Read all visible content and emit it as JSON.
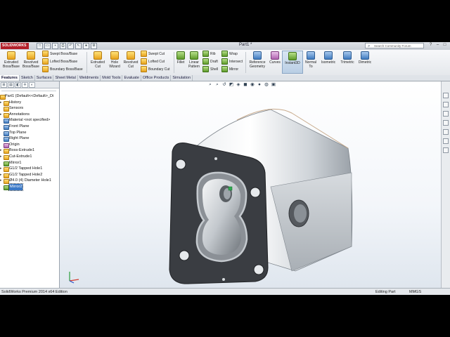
{
  "window": {
    "logo": "SOLIDWORKS",
    "document_title": "Part1 *",
    "search_placeholder": "Search Community Forum",
    "search_icon": "magnifier-icon",
    "window_buttons": [
      "?",
      "–",
      "□",
      "×"
    ]
  },
  "command_manager": {
    "extruded_boss": [
      "Extruded",
      "Boss/Base"
    ],
    "revolved_boss": [
      "Revolved",
      "Boss/Base"
    ],
    "swept_boss": "Swept Boss/Base",
    "lofted_boss": "Lofted Boss/Base",
    "boundary_boss": "Boundary Boss/Base",
    "extruded_cut": [
      "Extruded",
      "Cut"
    ],
    "hole_wizard": [
      "Hole",
      "Wizard"
    ],
    "revolved_cut": [
      "Revolved",
      "Cut"
    ],
    "swept_cut": "Swept Cut",
    "lofted_cut": "Lofted Cut",
    "boundary_cut": "Boundary Cut",
    "fillet": "Fillet",
    "linear_pattern": [
      "Linear",
      "Pattern"
    ],
    "rib": "Rib",
    "draft": "Draft",
    "shell": "Shell",
    "wrap": "Wrap",
    "intersect": "Intersect",
    "mirror": "Mirror",
    "reference_geometry": [
      "Reference",
      "Geometry"
    ],
    "curves": "Curves",
    "instant3d": "Instant3D",
    "normal_to": [
      "Normal",
      "To"
    ],
    "isometric": "Isometric",
    "trimetric": "Trimetric",
    "dimetric": "Dimetric"
  },
  "tabs": [
    "Features",
    "Sketch",
    "Surfaces",
    "Sheet Metal",
    "Weldments",
    "Mold Tools",
    "Evaluate",
    "Office Products",
    "Simulation"
  ],
  "feature_tree": {
    "root": "Part1  (Default<<Default>_Di",
    "items": [
      {
        "label": "History",
        "icon": "history-icon"
      },
      {
        "label": "Sensors",
        "icon": "sensor-icon"
      },
      {
        "label": "Annotations",
        "icon": "annotations-icon"
      },
      {
        "label": "Material <not specified>",
        "icon": "material-icon"
      },
      {
        "label": "Front Plane",
        "icon": "plane-icon"
      },
      {
        "label": "Top Plane",
        "icon": "plane-icon"
      },
      {
        "label": "Right Plane",
        "icon": "plane-icon"
      },
      {
        "label": "Origin",
        "icon": "origin-icon"
      },
      {
        "label": "Boss-Extrude1",
        "icon": "extrude-icon"
      },
      {
        "label": "Cut-Extrude1",
        "icon": "cut-icon"
      },
      {
        "label": "Mirror1",
        "icon": "mirror-icon"
      },
      {
        "label": "G1/2 Tapped Hole1",
        "icon": "hole-icon"
      },
      {
        "label": "G1/2 Tapped Hole2",
        "icon": "hole-icon"
      },
      {
        "label": "Ø4.0 (4) Diameter Hole1",
        "icon": "hole-icon"
      },
      {
        "label": "Mirror2",
        "icon": "mirror-icon"
      }
    ]
  },
  "status_bar": {
    "edition": "SolidWorks Premium 2014 x64 Edition",
    "mode": "Editing Part",
    "units": "MMGS"
  },
  "colors": {
    "model_metal": "#c9ced3",
    "model_dark_face": "#3a3d42",
    "selection_blue": "#3b79c7",
    "brand_red": "#b3202a"
  }
}
